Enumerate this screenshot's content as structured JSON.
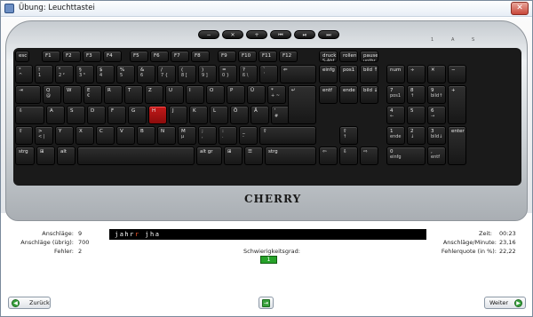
{
  "window": {
    "title": "Übung: Leuchttastei",
    "close_glyph": "✕"
  },
  "media_keys": [
    "−",
    "✕",
    "+",
    "⏮",
    "⏯",
    "⏭"
  ],
  "indicators": [
    "1",
    "A",
    "S"
  ],
  "keyboard": {
    "brand": "CHERRY",
    "rows": [
      [
        {
          "label": "esc"
        },
        {
          "label": "F1"
        },
        {
          "label": "F2"
        },
        {
          "label": "F3"
        },
        {
          "label": "F4"
        },
        {
          "label": "F5"
        },
        {
          "label": "F6"
        },
        {
          "label": "F7"
        },
        {
          "label": "F8"
        },
        {
          "label": "F9"
        },
        {
          "label": "F10"
        },
        {
          "label": "F11"
        },
        {
          "label": "F12"
        },
        {
          "label": "druck",
          "sub": "S-Abf"
        },
        {
          "label": "rollen"
        },
        {
          "label": "pause",
          "sub": "untbr"
        }
      ],
      [
        {
          "label": "°",
          "sub": "^"
        },
        {
          "label": "!",
          "sub": "1"
        },
        {
          "label": "\"",
          "sub": "2 ²"
        },
        {
          "label": "§",
          "sub": "3 ³"
        },
        {
          "label": "$",
          "sub": "4"
        },
        {
          "label": "%",
          "sub": "5"
        },
        {
          "label": "&",
          "sub": "6"
        },
        {
          "label": "/",
          "sub": "7 {"
        },
        {
          "label": "(",
          "sub": "8 ["
        },
        {
          "label": ")",
          "sub": "9 ]"
        },
        {
          "label": "=",
          "sub": "0 }"
        },
        {
          "label": "?",
          "sub": "ß \\"
        },
        {
          "label": "`",
          "sub": "´"
        },
        {
          "label": "⇐"
        },
        {
          "label": "einfg"
        },
        {
          "label": "pos1"
        },
        {
          "label": "bild ↑"
        },
        {
          "label": "num"
        },
        {
          "label": "÷"
        },
        {
          "label": "✕"
        },
        {
          "label": "−"
        }
      ],
      [
        {
          "label": "⇥"
        },
        {
          "label": "Q",
          "sub": "@"
        },
        {
          "label": "W"
        },
        {
          "label": "E",
          "sub": "€"
        },
        {
          "label": "R"
        },
        {
          "label": "T"
        },
        {
          "label": "Z"
        },
        {
          "label": "U"
        },
        {
          "label": "I"
        },
        {
          "label": "O"
        },
        {
          "label": "P"
        },
        {
          "label": "Ü"
        },
        {
          "label": "*",
          "sub": "+ ~"
        },
        {
          "label": "entf"
        },
        {
          "label": "ende"
        },
        {
          "label": "bild ↓"
        },
        {
          "label": "7",
          "sub": "pos1"
        },
        {
          "label": "8",
          "sub": "↑"
        },
        {
          "label": "9",
          "sub": "bild↑"
        },
        {
          "label": "+"
        }
      ],
      [
        {
          "label": "⇩"
        },
        {
          "label": "A"
        },
        {
          "label": "S"
        },
        {
          "label": "D"
        },
        {
          "label": "F"
        },
        {
          "label": "G"
        },
        {
          "label": "H"
        },
        {
          "label": "J"
        },
        {
          "label": "K"
        },
        {
          "label": "L"
        },
        {
          "label": "Ö"
        },
        {
          "label": "Ä"
        },
        {
          "label": "'",
          "sub": "#"
        },
        {
          "label": "↵"
        },
        {
          "label": "4",
          "sub": "←"
        },
        {
          "label": "5"
        },
        {
          "label": "6",
          "sub": "→"
        }
      ],
      [
        {
          "label": "⇧"
        },
        {
          "label": ">",
          "sub": "< |"
        },
        {
          "label": "Y"
        },
        {
          "label": "X"
        },
        {
          "label": "C"
        },
        {
          "label": "V"
        },
        {
          "label": "B"
        },
        {
          "label": "N"
        },
        {
          "label": "M",
          "sub": "µ"
        },
        {
          "label": ";",
          "sub": ","
        },
        {
          "label": ":",
          "sub": "."
        },
        {
          "label": "_",
          "sub": "-"
        },
        {
          "label": "⇧"
        },
        {
          "label": "⇧",
          "sub": "↑"
        },
        {
          "label": "1",
          "sub": "ende"
        },
        {
          "label": "2",
          "sub": "↓"
        },
        {
          "label": "3",
          "sub": "bild↓"
        },
        {
          "label": "enter"
        }
      ],
      [
        {
          "label": "strg"
        },
        {
          "label": "⊞"
        },
        {
          "label": "alt"
        },
        {
          "label": ""
        },
        {
          "label": "alt gr"
        },
        {
          "label": "⊞"
        },
        {
          "label": "☰"
        },
        {
          "label": "strg"
        },
        {
          "label": "⇦"
        },
        {
          "label": "⇩"
        },
        {
          "label": "⇨"
        },
        {
          "label": "0",
          "sub": "einfg"
        },
        {
          "label": ",",
          "sub": "entf"
        }
      ]
    ],
    "highlighted_key": "H"
  },
  "stats_left": [
    {
      "label": "Anschläge:",
      "value": "9"
    },
    {
      "label": "Anschläge (übrig):",
      "value": "700"
    },
    {
      "label": "Fehler:",
      "value": "2"
    }
  ],
  "stats_right": [
    {
      "label": "Zeit:",
      "value": "00:23"
    },
    {
      "label": "Anschläge/Minute:",
      "value": "23,16"
    },
    {
      "label": "Fehlerquote (in %):",
      "value": "22,22"
    }
  ],
  "typed": {
    "correct": "jahr",
    "error": "r",
    "rest": " jha"
  },
  "difficulty": {
    "label": "Schwierigkeitsgrad:",
    "value": "1"
  },
  "buttons": {
    "back": "Zurück",
    "next": "Weiter"
  }
}
